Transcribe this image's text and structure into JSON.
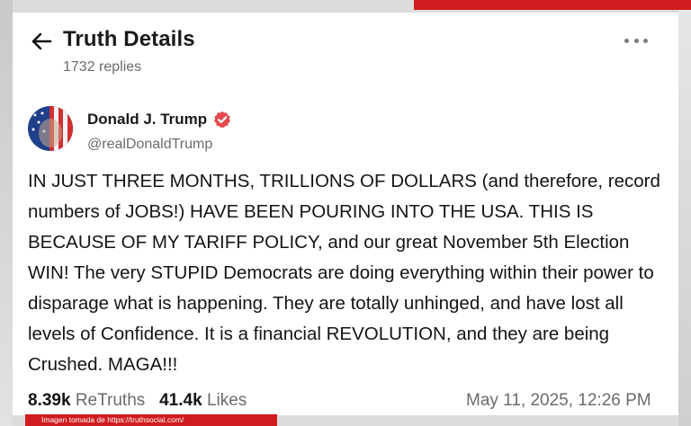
{
  "header": {
    "title": "Truth Details",
    "replies": "1732 replies"
  },
  "post": {
    "author_name": "Donald J. Trump",
    "author_handle": "@realDonaldTrump",
    "body": "IN JUST THREE MONTHS, TRILLIONS OF DOLLARS (and therefore, record numbers of JOBS!) HAVE BEEN POURING INTO THE USA. THIS IS BECAUSE OF MY TARIFF POLICY, and our great November 5th Election WIN! The very STUPID Democrats are doing everything within their power to disparage what is happening. They are totally unhinged, and have lost all levels of Confidence. It is a financial REVOLUTION, and they are being Crushed. MAGA!!!",
    "retruths_count": "8.39k",
    "retruths_label": "ReTruths",
    "likes_count": "41.4k",
    "likes_label": "Likes",
    "timestamp": "May 11, 2025, 12:26 PM"
  },
  "caption": "Imagen tomada de https://truthsocial.com/",
  "icons": {
    "back": "arrow-left-icon",
    "more": "more-horizontal-icon",
    "verified": "verified-badge-icon",
    "avatar": "avatar-image"
  },
  "colors": {
    "accent_red": "#d01c1f",
    "verified": "#e5484d",
    "muted_text": "#6b6b6b"
  }
}
